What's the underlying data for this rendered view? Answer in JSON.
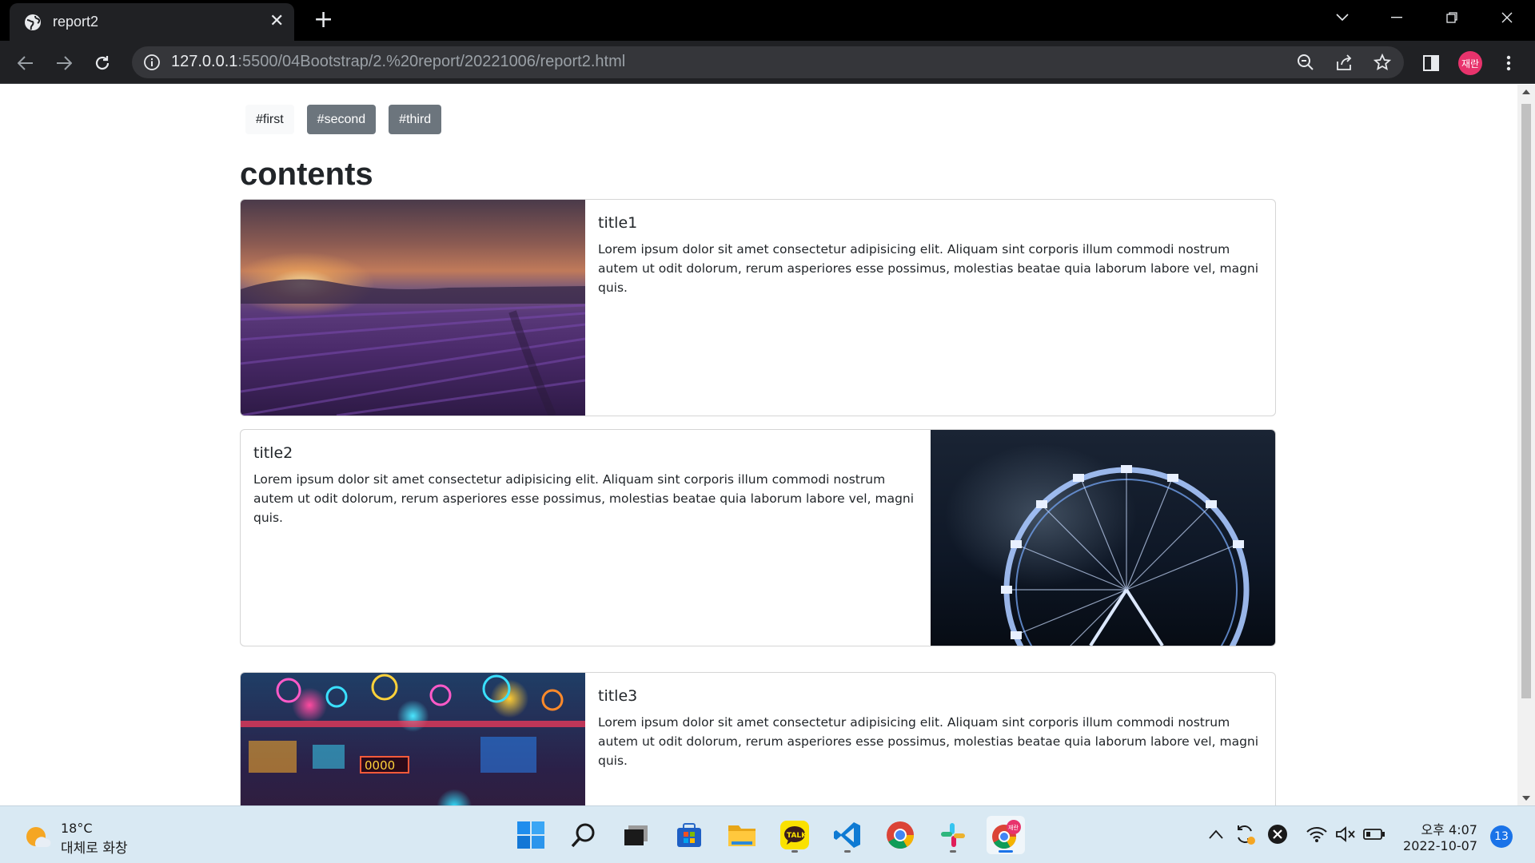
{
  "browser": {
    "tab_title": "report2",
    "tab_close": "✕",
    "new_tab": "+",
    "url_host": "127.0.0.1",
    "url_rest": ":5500/04Bootstrap/2.%20report/20221006/report2.html",
    "profile_label": "재란",
    "profile_color": "#e8336c"
  },
  "page": {
    "tags": [
      {
        "label": "#first",
        "style": "light"
      },
      {
        "label": "#second",
        "style": "dark"
      },
      {
        "label": "#third",
        "style": "dark"
      }
    ],
    "heading": "contents",
    "cards": [
      {
        "title": "title1",
        "text": "Lorem ipsum dolor sit amet consectetur adipisicing elit. Aliquam sint corporis illum commodi nostrum autem ut odit dolorum, rerum asperiores esse possimus, molestias beatae quia laborum labore vel, magni quis.",
        "image": "lavender-field-sunset",
        "image_side": "left"
      },
      {
        "title": "title2",
        "text": "Lorem ipsum dolor sit amet consectetur adipisicing elit. Aliquam sint corporis illum commodi nostrum autem ut odit dolorum, rerum asperiores esse possimus, molestias beatae quia laborum labore vel, magni quis.",
        "image": "ferris-wheel-night",
        "image_side": "right"
      },
      {
        "title": "title3",
        "text": "Lorem ipsum dolor sit amet consectetur adipisicing elit. Aliquam sint corporis illum commodi nostrum autem ut odit dolorum, rerum asperiores esse possimus, molestias beatae quia laborum labore vel, magni quis.",
        "image": "neon-arcade",
        "image_side": "left"
      }
    ],
    "neon_sign": "0000"
  },
  "taskbar": {
    "weather_temp": "18°C",
    "weather_desc": "대체로 화창",
    "apps": [
      "windows-start",
      "search",
      "task-view",
      "microsoft-store",
      "file-explorer",
      "kakaotalk",
      "vscode",
      "chrome",
      "slack",
      "chrome-profile"
    ],
    "kakaotalk_label": "TALK",
    "chrome_profile_badge": "재란",
    "clock_time": "오후 4:07",
    "clock_date": "2022-10-07",
    "notification_count": "13"
  }
}
